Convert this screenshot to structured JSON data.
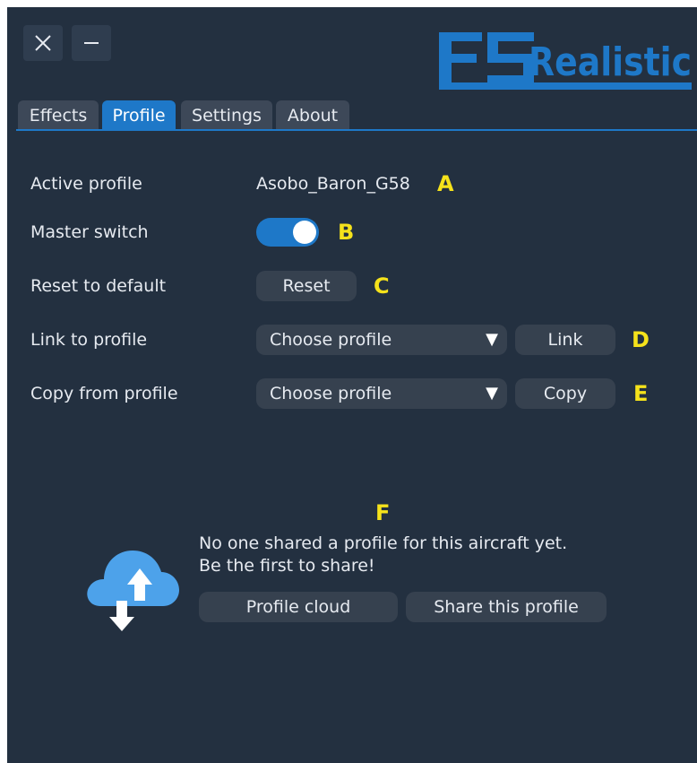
{
  "window": {
    "close_icon": "close-icon",
    "minimize_icon": "minimize-icon"
  },
  "logo": {
    "text": "FSRealistic"
  },
  "tabs": [
    {
      "label": "Effects"
    },
    {
      "label": "Profile",
      "active": true
    },
    {
      "label": "Settings"
    },
    {
      "label": "About"
    }
  ],
  "profile": {
    "active_profile_label": "Active profile",
    "active_profile_value": "Asobo_Baron_G58",
    "master_switch_label": "Master switch",
    "master_switch_on": true,
    "reset_label": "Reset to default",
    "reset_button": "Reset",
    "link_label": "Link to profile",
    "link_select": "Choose profile",
    "link_button": "Link",
    "copy_label": "Copy from profile",
    "copy_select": "Choose profile",
    "copy_button": "Copy",
    "dropdown_arrow": "▼"
  },
  "markers": {
    "a": "A",
    "b": "B",
    "c": "C",
    "d": "D",
    "e": "E",
    "f": "F"
  },
  "cloud": {
    "message_line1": "No one shared a profile for this aircraft yet.",
    "message_line2": "Be the first to share!",
    "profile_cloud_button": "Profile cloud",
    "share_button": "Share this profile"
  },
  "colors": {
    "background": "#233040",
    "accent": "#1e78c8",
    "marker": "#f5e21b",
    "control": "#36414f"
  }
}
